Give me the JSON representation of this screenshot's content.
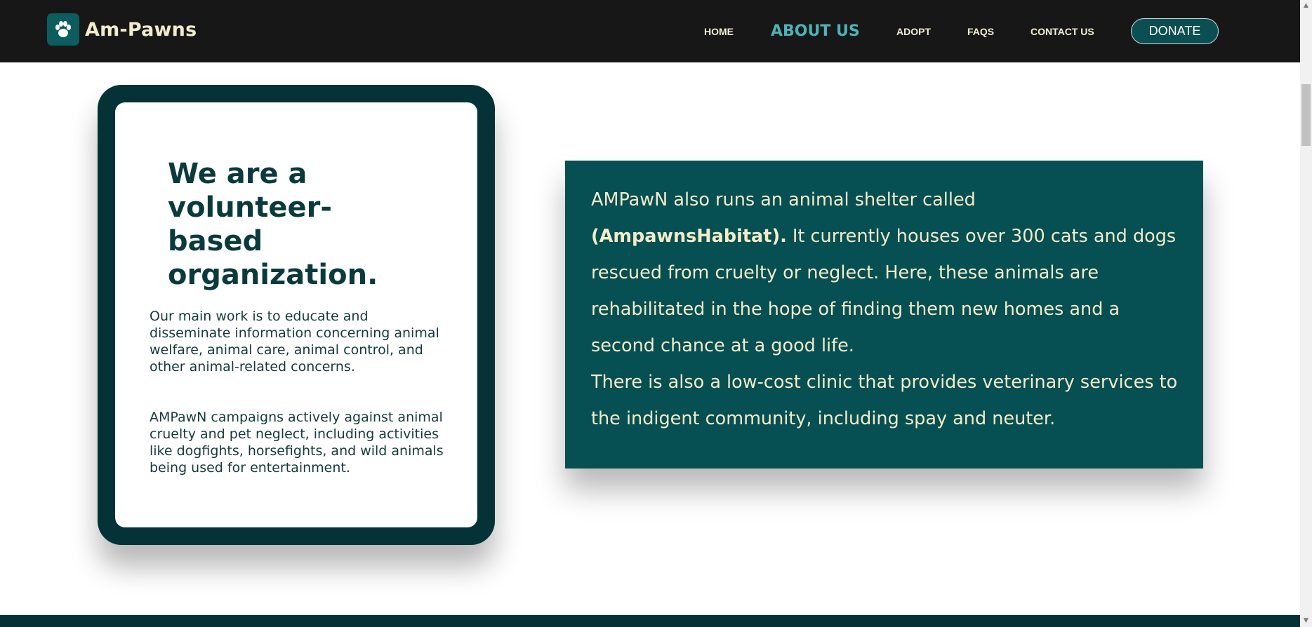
{
  "brand": {
    "name": "Am-Pawns",
    "logo_icon": "paw-icon"
  },
  "nav": {
    "items": [
      {
        "label": "HOME"
      },
      {
        "label": "ABOUT US"
      },
      {
        "label": "ADOPT"
      },
      {
        "label": "FAQS"
      },
      {
        "label": "CONTACT US"
      }
    ],
    "active": "ABOUT US",
    "donate_label": "DONATE"
  },
  "left_card": {
    "heading": "We are a volunteer-based organization.",
    "paragraphs": [
      "Our main work is to educate and disseminate information concerning animal welfare, animal care, animal control, and other animal-related concerns.",
      "AMPawN campaigns actively against animal cruelty and pet neglect, including activities like dogfights, horsefights, and wild animals being used for entertainment."
    ]
  },
  "right_card": {
    "intro": "AMPawN also runs an animal shelter called",
    "highlight": "(AmpawnsHabitat).",
    "shelter_text": "It currently houses over 300 cats and dogs rescued from cruelty or neglect. Here, these animals are rehabilitated in the hope of finding them new homes and a second chance at a good life.",
    "clinic_text": "There is also a low-cost clinic that provides veterinary services to the indigent community, including spay and neuter."
  },
  "colors": {
    "navbar_bg": "#171717",
    "nav_text": "#f4efd3",
    "nav_active": "#4cb3b8",
    "teal_dark": "#053236",
    "teal_panel": "#064f52",
    "cream_text": "#f3ecc9"
  }
}
